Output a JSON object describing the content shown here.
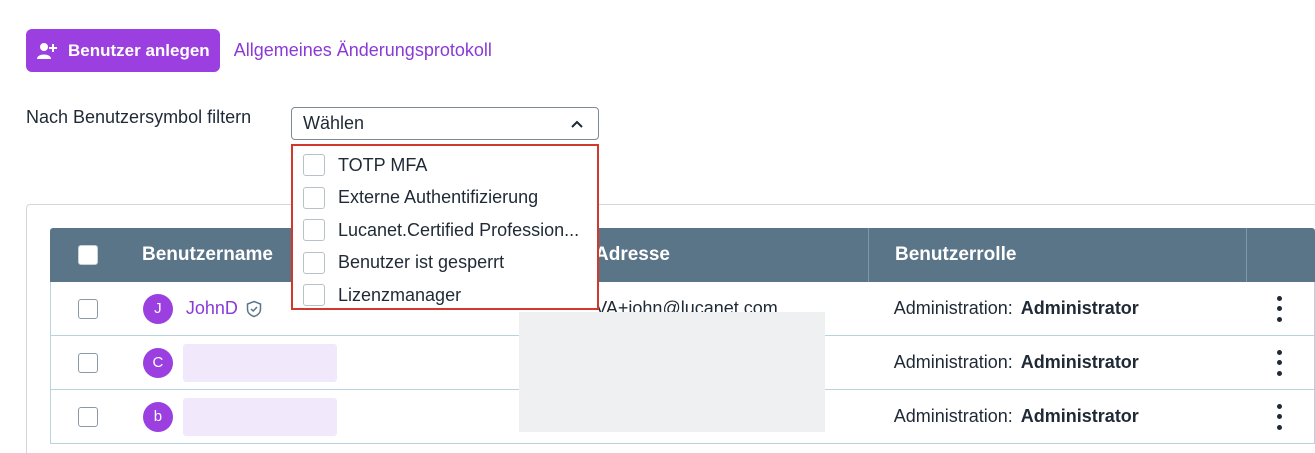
{
  "toolbar": {
    "create_user_label": "Benutzer anlegen",
    "changelog_link": "Allgemeines Änderungsprotokoll"
  },
  "filter": {
    "label": "Nach Benutzersymbol filtern",
    "select_value": "Wählen",
    "options": [
      "TOTP MFA",
      "Externe Authentifizierung",
      "Lucanet.Certified Profession...",
      "Benutzer ist gesperrt",
      "Lizenzmanager"
    ]
  },
  "table": {
    "headers": {
      "username": "Benutzername",
      "email": "Adresse",
      "role": "Benutzerrolle"
    },
    "rows": [
      {
        "initial": "J",
        "username": "JohnD",
        "email": "VA+john@lucanet.com",
        "role_prefix": "Administration:",
        "role": "Administrator"
      },
      {
        "initial": "C",
        "username": "",
        "email": "",
        "role_prefix": "Administration:",
        "role": "Administrator"
      },
      {
        "initial": "b",
        "username": "",
        "email": "",
        "role_prefix": "Administration:",
        "role": "Administrator"
      }
    ]
  },
  "colors": {
    "accent": "#9b3fe0",
    "header_bg": "#5a7588",
    "dropdown_border": "#d0392b"
  },
  "icons": [
    "add-user-icon",
    "chevron-up-icon",
    "shield-check-icon",
    "kebab-menu-icon"
  ]
}
